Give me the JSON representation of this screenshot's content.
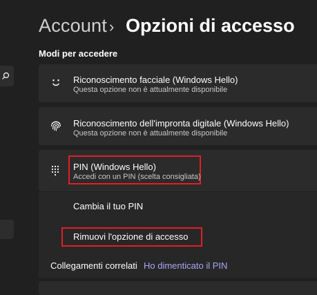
{
  "breadcrumb": {
    "parent": "Account",
    "separator": "›",
    "current": "Opzioni di accesso"
  },
  "section": {
    "title": "Modi per accedere"
  },
  "options": [
    {
      "title": "Riconoscimento facciale (Windows Hello)",
      "subtitle": "Questa opzione non è attualmente disponibile",
      "icon": "face-icon"
    },
    {
      "title": "Riconoscimento dell'impronta digitale (Windows Hello)",
      "subtitle": "Questa opzione non è attualmente disponibile",
      "icon": "fingerprint-icon"
    },
    {
      "title": "PIN (Windows Hello)",
      "subtitle": "Accedi con un PIN (scelta consigliata)",
      "icon": "pin-keypad-icon"
    }
  ],
  "pin_actions": {
    "change": "Cambia il tuo PIN",
    "remove": "Rimuovi l'opzione di accesso"
  },
  "related": {
    "label": "Collegamenti correlati",
    "link": "Ho dimenticato il PIN"
  },
  "colors": {
    "background": "#202020",
    "card": "#2b2b2b",
    "highlight_border": "#e01f26",
    "link": "#a9a7f5"
  }
}
